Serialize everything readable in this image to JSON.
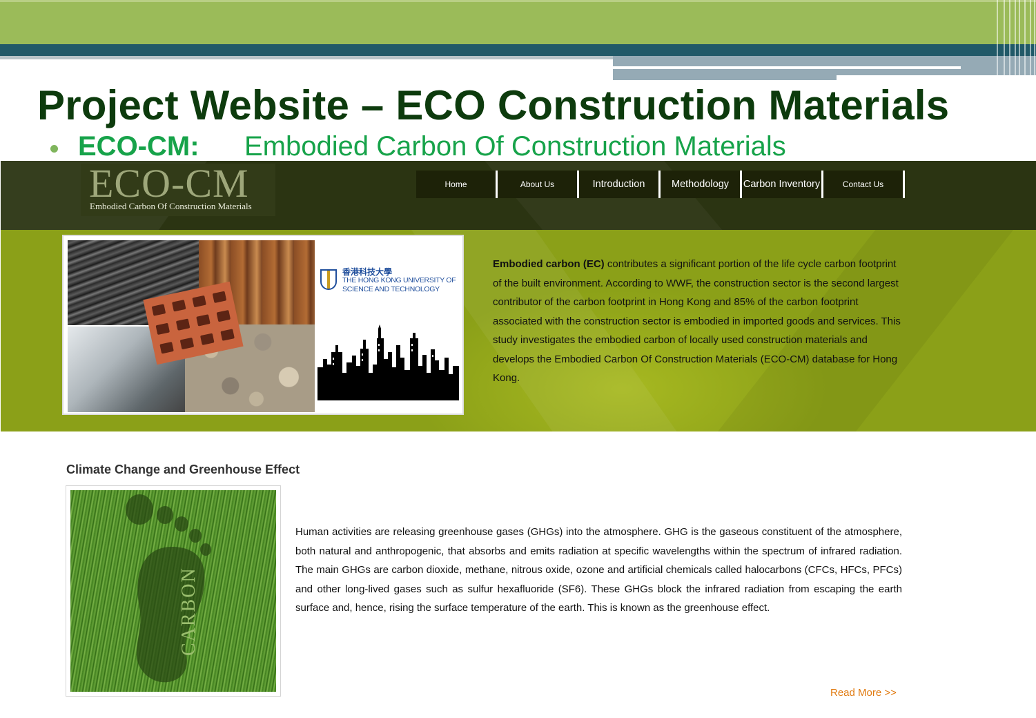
{
  "slide": {
    "title": "Project Website – ECO Construction Materials",
    "bullet_label": "ECO-CM:",
    "bullet_text": "Embodied Carbon Of Construction Materials"
  },
  "colors": {
    "slide_green": "#9bbb59",
    "slide_teal": "#215968",
    "title_text": "#0d3b0d",
    "bullet_green": "#17a34a",
    "header_bg": "#2b3412",
    "hero_bg": "#8ba018",
    "read_more": "#e07a10"
  },
  "site": {
    "logo": {
      "main": "ECO-CM",
      "sub": "Embodied Carbon Of Construction Materials"
    },
    "nav": [
      {
        "label": "Home",
        "name": "nav-home"
      },
      {
        "label": "About Us",
        "name": "nav-about-us"
      },
      {
        "label": "Introduction",
        "name": "nav-introduction"
      },
      {
        "label": "Methodology",
        "name": "nav-methodology"
      },
      {
        "label": "Carbon Inventory",
        "name": "nav-carbon-inventory"
      },
      {
        "label": "Contact Us",
        "name": "nav-contact-us"
      }
    ],
    "university": {
      "chinese": "香港科技大學",
      "line1": "THE HONG KONG UNIVERSITY OF",
      "line2": "SCIENCE AND TECHNOLOGY"
    },
    "hero": {
      "lead_bold": "Embodied carbon (EC)",
      "lead_rest": " contributes a significant portion of the life cycle carbon footprint of the built environment. According to WWF, the construction sector is the second largest contributor of the carbon footprint in Hong Kong and 85% of the carbon footprint associated with the construction sector is embodied in imported goods and services. This study investigates the embodied carbon of locally used construction materials and develops the Embodied Carbon Of Construction Materials (ECO-CM) database for Hong Kong."
    },
    "section": {
      "title": "Climate Change and Greenhouse Effect",
      "image_text": "CARBON",
      "body": "Human activities are releasing greenhouse gases (GHGs) into the atmosphere. GHG is the gaseous constituent of the atmosphere, both natural and anthropogenic, that absorbs and emits radiation at specific wavelengths within the spectrum of infrared radiation. The main GHGs are carbon dioxide, methane, nitrous oxide, ozone and artificial chemicals called halocarbons (CFCs, HFCs, PFCs) and other long-lived gases such as sulfur hexafluoride (SF6). These GHGs block the infrared radiation from escaping the earth surface and, hence, rising the surface temperature of the earth. This is known as the greenhouse effect.",
      "read_more": "Read More >>"
    }
  }
}
